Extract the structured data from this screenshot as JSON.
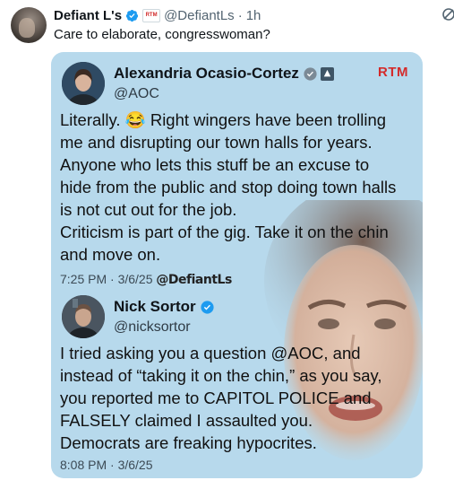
{
  "tweet": {
    "author_name": "Defiant L's",
    "handle": "@DefiantLs",
    "separator": "·",
    "time": "1h",
    "badge_text": "RTM",
    "text": "Care to elaborate, congresswoman?"
  },
  "quoted": {
    "aoc": {
      "name": "Alexandria Ocasio-Cortez",
      "handle": "@AOC",
      "watermark": "RTM",
      "lines": [
        "Literally. 😂 Right wingers have been trolling",
        "me and disrupting our town halls for years.",
        "Anyone who lets this stuff be an excuse to",
        "hide from the public and stop doing town halls",
        "is not cut out for the job.",
        "Criticism is part of the gig. Take it on the chin",
        "and move on."
      ],
      "meta_time": "7:25 PM · 3/6/25",
      "meta_watermark": "@DefiantLs"
    },
    "nick": {
      "name": "Nick Sortor",
      "handle": "@nicksortor",
      "lines": [
        "I tried asking you a question @AOC, and",
        "instead of “taking it on the chin,” as you say,",
        "you reported me to CAPITOL POLICE and",
        "FALSELY claimed I assaulted you.",
        "Democrats are freaking hypocrites."
      ],
      "meta_time": "8:08 PM · 3/6/25"
    }
  },
  "colors": {
    "media_bg": "#b7d9ec",
    "verified_blue": "#1d9bf0",
    "accent_red": "#d42b2b"
  }
}
